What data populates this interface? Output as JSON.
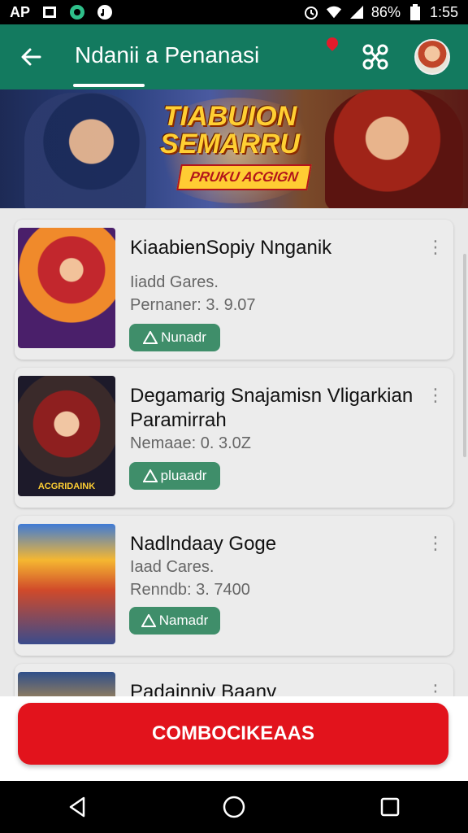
{
  "status_bar": {
    "left_text": "AP",
    "battery": "86%",
    "time": "1:55"
  },
  "app_bar": {
    "title": "Ndanii a Penanasi"
  },
  "banner": {
    "title": "TIABUION SEMARRU",
    "subtitle": "PRUKU ACGIGN"
  },
  "games": [
    {
      "title": "KiaabienSopiy Nnganik",
      "subtitle": "Iiadd Gares.",
      "version": "Pernaner: 3. 9.07",
      "button_label": "Nunadr",
      "thumb_label": ""
    },
    {
      "title": "Degamarig Snajamisn Vligarkian Paramirrah",
      "subtitle": "",
      "version": "Nemaae: 0. 3.0Z",
      "button_label": "pluaadr",
      "thumb_label": "ACGRIDAINK"
    },
    {
      "title": "Nadlndaay Goge",
      "subtitle": "Iaad Cares.",
      "version": "Renndb: 3. 7400",
      "button_label": "Namadr",
      "thumb_label": ""
    },
    {
      "title": "Padainniy Baanv",
      "subtitle": "",
      "version": "",
      "button_label": "",
      "thumb_label": ""
    }
  ],
  "cta": {
    "label": "COMBOCIKEAAS"
  },
  "colors": {
    "app_bar": "#137a5f",
    "install_button": "#3f8e6a",
    "cta": "#e2131c"
  }
}
